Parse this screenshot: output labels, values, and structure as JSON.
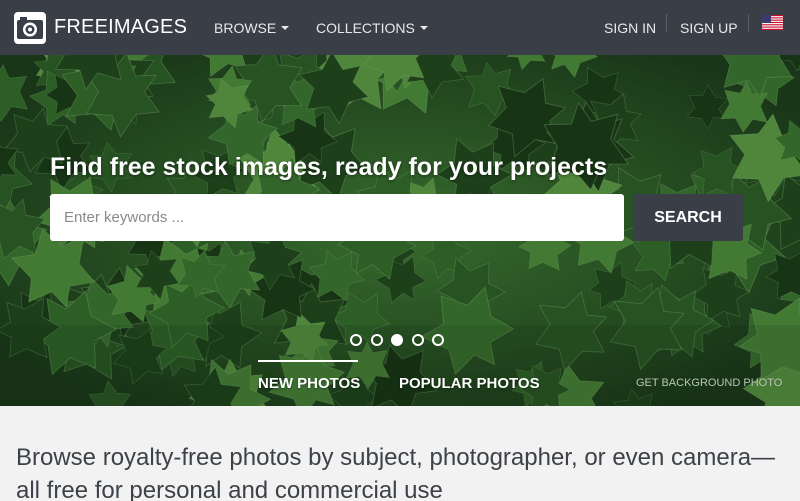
{
  "brand": {
    "name": "FREEIMAGES"
  },
  "nav": {
    "browse": "BROWSE",
    "collections": "COLLECTIONS",
    "sign_in": "SIGN IN",
    "sign_up": "SIGN UP"
  },
  "hero": {
    "title": "Find free stock images, ready for your projects",
    "search_placeholder": "Enter keywords ...",
    "search_button": "SEARCH",
    "slides": {
      "count": 5,
      "active_index": 2
    },
    "tabs": [
      {
        "label": "NEW PHOTOS",
        "active": true
      },
      {
        "label": "POPULAR PHOTOS",
        "active": false
      }
    ],
    "background_link": "GET BACKGROUND PHOTO"
  },
  "main": {
    "heading": "Browse royalty-free photos by subject, photographer, or even camera— all free for personal and commercial use"
  },
  "icons": [
    "camera-logo-icon",
    "chevron-down-icon",
    "us-flag-icon"
  ],
  "colors": {
    "navbar": "#3a3f47",
    "search_button": "#3a3f47",
    "page_background": "#f2f2f2",
    "leaf_dark": "#1f4a1f",
    "leaf_light": "#5f9a45"
  }
}
